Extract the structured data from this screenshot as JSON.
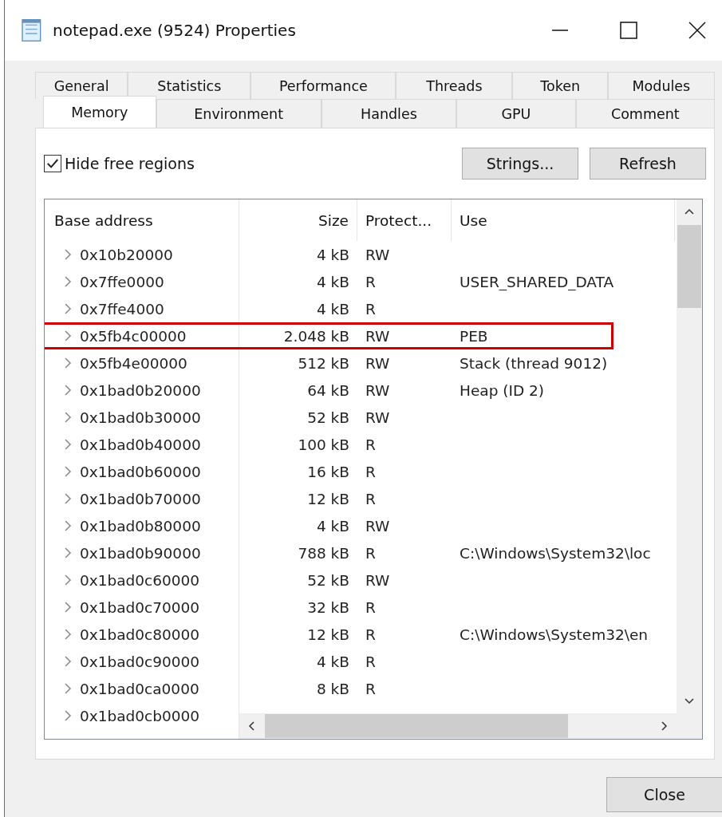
{
  "window": {
    "title": "notepad.exe (9524) Properties"
  },
  "tab_rows": [
    [
      {
        "label": "General",
        "selected": false
      },
      {
        "label": "Statistics",
        "selected": false
      },
      {
        "label": "Performance",
        "selected": false
      },
      {
        "label": "Threads",
        "selected": false
      },
      {
        "label": "Token",
        "selected": false
      },
      {
        "label": "Modules",
        "selected": false
      }
    ],
    [
      {
        "label": "Memory",
        "selected": true
      },
      {
        "label": "Environment",
        "selected": false
      },
      {
        "label": "Handles",
        "selected": false
      },
      {
        "label": "GPU",
        "selected": false
      },
      {
        "label": "Comment",
        "selected": false
      }
    ]
  ],
  "hide_free_regions": {
    "label": "Hide free regions",
    "checked": true
  },
  "buttons": [
    "Strings...",
    "Refresh"
  ],
  "table": {
    "columns": [
      "Base address",
      "Size",
      "Protect...",
      "Use"
    ],
    "rows": [
      {
        "address": "0x10b20000",
        "size": "4 kB",
        "protect": "RW",
        "use": "",
        "highlighted": false
      },
      {
        "address": "0x7ffe0000",
        "size": "4 kB",
        "protect": "R",
        "use": "USER_SHARED_DATA",
        "highlighted": false
      },
      {
        "address": "0x7ffe4000",
        "size": "4 kB",
        "protect": "R",
        "use": "",
        "highlighted": false
      },
      {
        "address": "0x5fb4c00000",
        "size": "2.048 kB",
        "protect": "RW",
        "use": "PEB",
        "highlighted": true
      },
      {
        "address": "0x5fb4e00000",
        "size": "512 kB",
        "protect": "RW",
        "use": "Stack (thread 9012)",
        "highlighted": false
      },
      {
        "address": "0x1bad0b20000",
        "size": "64 kB",
        "protect": "RW",
        "use": "Heap (ID 2)",
        "highlighted": false
      },
      {
        "address": "0x1bad0b30000",
        "size": "52 kB",
        "protect": "RW",
        "use": "",
        "highlighted": false
      },
      {
        "address": "0x1bad0b40000",
        "size": "100 kB",
        "protect": "R",
        "use": "",
        "highlighted": false
      },
      {
        "address": "0x1bad0b60000",
        "size": "16 kB",
        "protect": "R",
        "use": "",
        "highlighted": false
      },
      {
        "address": "0x1bad0b70000",
        "size": "12 kB",
        "protect": "R",
        "use": "",
        "highlighted": false
      },
      {
        "address": "0x1bad0b80000",
        "size": "4 kB",
        "protect": "RW",
        "use": "",
        "highlighted": false
      },
      {
        "address": "0x1bad0b90000",
        "size": "788 kB",
        "protect": "R",
        "use": "C:\\Windows\\System32\\loc",
        "highlighted": false
      },
      {
        "address": "0x1bad0c60000",
        "size": "52 kB",
        "protect": "RW",
        "use": "",
        "highlighted": false
      },
      {
        "address": "0x1bad0c70000",
        "size": "32 kB",
        "protect": "R",
        "use": "",
        "highlighted": false
      },
      {
        "address": "0x1bad0c80000",
        "size": "12 kB",
        "protect": "R",
        "use": "C:\\Windows\\System32\\en",
        "highlighted": false
      },
      {
        "address": "0x1bad0c90000",
        "size": "4 kB",
        "protect": "R",
        "use": "",
        "highlighted": false
      },
      {
        "address": "0x1bad0ca0000",
        "size": "8 kB",
        "protect": "R",
        "use": "",
        "highlighted": false
      },
      {
        "address": "0x1bad0cb0000",
        "size": "",
        "protect": "",
        "use": "",
        "highlighted": false
      }
    ]
  },
  "close_button": "Close"
}
